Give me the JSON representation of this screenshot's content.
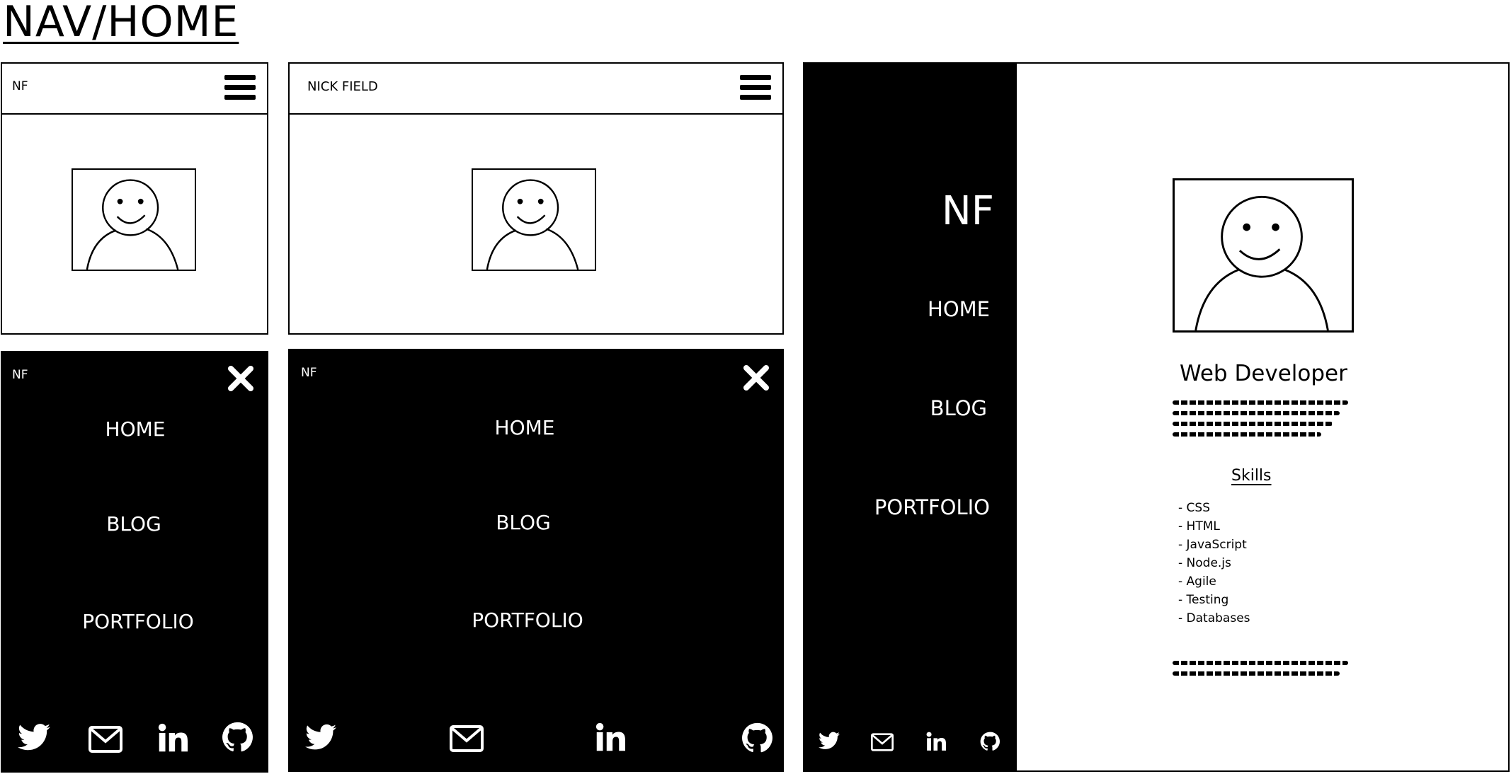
{
  "page_title": "NAV/HOME",
  "mobile_closed": {
    "brand": "NF"
  },
  "tablet_closed": {
    "brand": "NICK FIELD"
  },
  "mobile_open": {
    "brand": "NF",
    "menu": [
      "HOME",
      "BLOG",
      "PORTFOLIO"
    ],
    "social": [
      "twitter-icon",
      "mail-icon",
      "linkedin-icon",
      "github-icon"
    ]
  },
  "tablet_open": {
    "brand": "NF",
    "menu": [
      "HOME",
      "BLOG",
      "PORTFOLIO"
    ],
    "social": [
      "twitter-icon",
      "mail-icon",
      "linkedin-icon",
      "github-icon"
    ]
  },
  "desktop": {
    "sidebar": {
      "brand": "NF",
      "menu": [
        "HOME",
        "BLOG",
        "PORTFOLIO"
      ],
      "social": [
        "twitter-icon",
        "mail-icon",
        "linkedin-icon",
        "github-icon"
      ]
    },
    "main": {
      "heading": "Web Developer",
      "skills_title": "Skills",
      "skills": [
        "- CSS",
        "- HTML",
        "- JavaScript",
        "- Node.js",
        "- Agile",
        "- Testing",
        "- Databases"
      ]
    }
  },
  "colors": {
    "ink": "#000000",
    "paper": "#ffffff"
  }
}
